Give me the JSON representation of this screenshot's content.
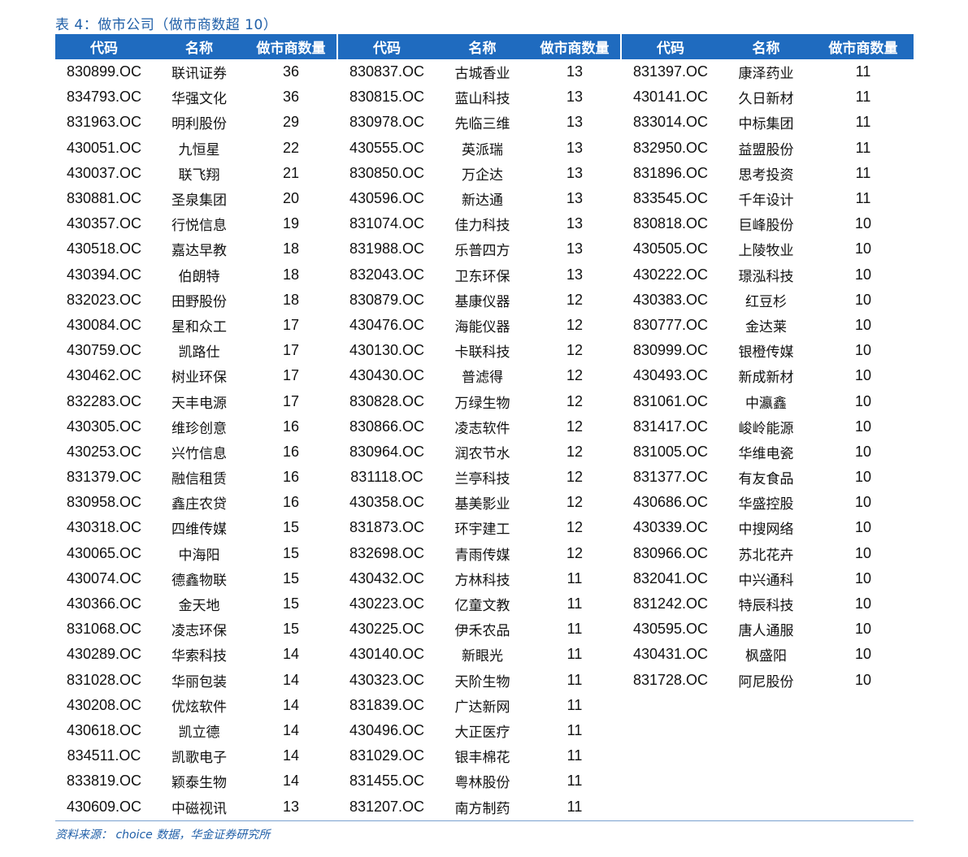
{
  "caption": "表 4：做市公司（做市商数超 10）",
  "headers": [
    "代码",
    "名称",
    "做市商数量",
    "代码",
    "名称",
    "做市商数量",
    "代码",
    "名称",
    "做市商数量"
  ],
  "rows": [
    [
      "830899.OC",
      "联讯证券",
      "36",
      "830837.OC",
      "古城香业",
      "13",
      "831397.OC",
      "康泽药业",
      "11"
    ],
    [
      "834793.OC",
      "华强文化",
      "36",
      "830815.OC",
      "蓝山科技",
      "13",
      "430141.OC",
      "久日新材",
      "11"
    ],
    [
      "831963.OC",
      "明利股份",
      "29",
      "830978.OC",
      "先临三维",
      "13",
      "833014.OC",
      "中标集团",
      "11"
    ],
    [
      "430051.OC",
      "九恒星",
      "22",
      "430555.OC",
      "英派瑞",
      "13",
      "832950.OC",
      "益盟股份",
      "11"
    ],
    [
      "430037.OC",
      "联飞翔",
      "21",
      "830850.OC",
      "万企达",
      "13",
      "831896.OC",
      "思考投资",
      "11"
    ],
    [
      "830881.OC",
      "圣泉集团",
      "20",
      "430596.OC",
      "新达通",
      "13",
      "833545.OC",
      "千年设计",
      "11"
    ],
    [
      "430357.OC",
      "行悦信息",
      "19",
      "831074.OC",
      "佳力科技",
      "13",
      "830818.OC",
      "巨峰股份",
      "10"
    ],
    [
      "430518.OC",
      "嘉达早教",
      "18",
      "831988.OC",
      "乐普四方",
      "13",
      "430505.OC",
      "上陵牧业",
      "10"
    ],
    [
      "430394.OC",
      "伯朗特",
      "18",
      "832043.OC",
      "卫东环保",
      "13",
      "430222.OC",
      "璟泓科技",
      "10"
    ],
    [
      "832023.OC",
      "田野股份",
      "18",
      "830879.OC",
      "基康仪器",
      "12",
      "430383.OC",
      "红豆杉",
      "10"
    ],
    [
      "430084.OC",
      "星和众工",
      "17",
      "430476.OC",
      "海能仪器",
      "12",
      "830777.OC",
      "金达莱",
      "10"
    ],
    [
      "430759.OC",
      "凯路仕",
      "17",
      "430130.OC",
      "卡联科技",
      "12",
      "830999.OC",
      "银橙传媒",
      "10"
    ],
    [
      "430462.OC",
      "树业环保",
      "17",
      "430430.OC",
      "普滤得",
      "12",
      "430493.OC",
      "新成新材",
      "10"
    ],
    [
      "832283.OC",
      "天丰电源",
      "17",
      "830828.OC",
      "万绿生物",
      "12",
      "831061.OC",
      "中瀛鑫",
      "10"
    ],
    [
      "430305.OC",
      "维珍创意",
      "16",
      "830866.OC",
      "凌志软件",
      "12",
      "831417.OC",
      "峻岭能源",
      "10"
    ],
    [
      "430253.OC",
      "兴竹信息",
      "16",
      "830964.OC",
      "润农节水",
      "12",
      "831005.OC",
      "华维电瓷",
      "10"
    ],
    [
      "831379.OC",
      "融信租赁",
      "16",
      "831118.OC",
      "兰亭科技",
      "12",
      "831377.OC",
      "有友食品",
      "10"
    ],
    [
      "830958.OC",
      "鑫庄农贷",
      "16",
      "430358.OC",
      "基美影业",
      "12",
      "430686.OC",
      "华盛控股",
      "10"
    ],
    [
      "430318.OC",
      "四维传媒",
      "15",
      "831873.OC",
      "环宇建工",
      "12",
      "430339.OC",
      "中搜网络",
      "10"
    ],
    [
      "430065.OC",
      "中海阳",
      "15",
      "832698.OC",
      "青雨传媒",
      "12",
      "830966.OC",
      "苏北花卉",
      "10"
    ],
    [
      "430074.OC",
      "德鑫物联",
      "15",
      "430432.OC",
      "方林科技",
      "11",
      "832041.OC",
      "中兴通科",
      "10"
    ],
    [
      "430366.OC",
      "金天地",
      "15",
      "430223.OC",
      "亿童文教",
      "11",
      "831242.OC",
      "特辰科技",
      "10"
    ],
    [
      "831068.OC",
      "凌志环保",
      "15",
      "430225.OC",
      "伊禾农品",
      "11",
      "430595.OC",
      "唐人通服",
      "10"
    ],
    [
      "430289.OC",
      "华索科技",
      "14",
      "430140.OC",
      "新眼光",
      "11",
      "430431.OC",
      "枫盛阳",
      "10"
    ],
    [
      "831028.OC",
      "华丽包装",
      "14",
      "430323.OC",
      "天阶生物",
      "11",
      "831728.OC",
      "阿尼股份",
      "10"
    ],
    [
      "430208.OC",
      "优炫软件",
      "14",
      "831839.OC",
      "广达新网",
      "11",
      "",
      "",
      ""
    ],
    [
      "430618.OC",
      "凯立德",
      "14",
      "430496.OC",
      "大正医疗",
      "11",
      "",
      "",
      ""
    ],
    [
      "834511.OC",
      "凯歌电子",
      "14",
      "831029.OC",
      "银丰棉花",
      "11",
      "",
      "",
      ""
    ],
    [
      "833819.OC",
      "颖泰生物",
      "14",
      "831455.OC",
      "粤林股份",
      "11",
      "",
      "",
      ""
    ],
    [
      "430609.OC",
      "中磁视讯",
      "13",
      "831207.OC",
      "南方制药",
      "11",
      "",
      "",
      ""
    ]
  ],
  "source": "资料来源：  choice 数据，华金证券研究所",
  "colors": {
    "header_bg": "#1f6bbf",
    "header_text": "#ffffff",
    "caption_text": "#1f5fa8"
  }
}
